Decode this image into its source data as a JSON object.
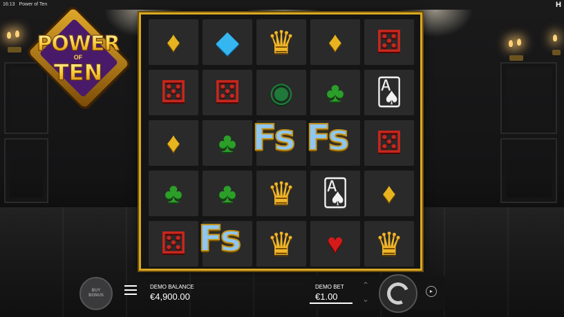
{
  "window": {
    "time": "16:13",
    "title": "Power of Ten",
    "provider_logo": "H"
  },
  "logo": {
    "line1": "POWER",
    "line2": "OF",
    "line3": "TEN"
  },
  "grid": {
    "rows": [
      [
        {
          "symbol": "diamond"
        },
        {
          "symbol": "gem"
        },
        {
          "symbol": "crown"
        },
        {
          "symbol": "diamond"
        },
        {
          "symbol": "dice"
        }
      ],
      [
        {
          "symbol": "dice"
        },
        {
          "symbol": "dice"
        },
        {
          "symbol": "chips"
        },
        {
          "symbol": "club"
        },
        {
          "symbol": "cards"
        }
      ],
      [
        {
          "symbol": "diamond"
        },
        {
          "symbol": "club"
        },
        {
          "symbol": "free-spins"
        },
        {
          "symbol": "free-spins"
        },
        {
          "symbol": "dice"
        }
      ],
      [
        {
          "symbol": "club"
        },
        {
          "symbol": "club"
        },
        {
          "symbol": "crown"
        },
        {
          "symbol": "cards"
        },
        {
          "symbol": "diamond"
        }
      ],
      [
        {
          "symbol": "dice"
        },
        {
          "symbol": "free-spins"
        },
        {
          "symbol": "crown"
        },
        {
          "symbol": "heart"
        },
        {
          "symbol": "crown"
        }
      ]
    ],
    "free_spins_text": "Fs"
  },
  "controls": {
    "buy_bonus_label": "BUY BONUS",
    "balance_label": "DEMO BALANCE",
    "balance_value": "€4,900.00",
    "bet_label": "DEMO BET",
    "bet_value": "€1.00"
  }
}
